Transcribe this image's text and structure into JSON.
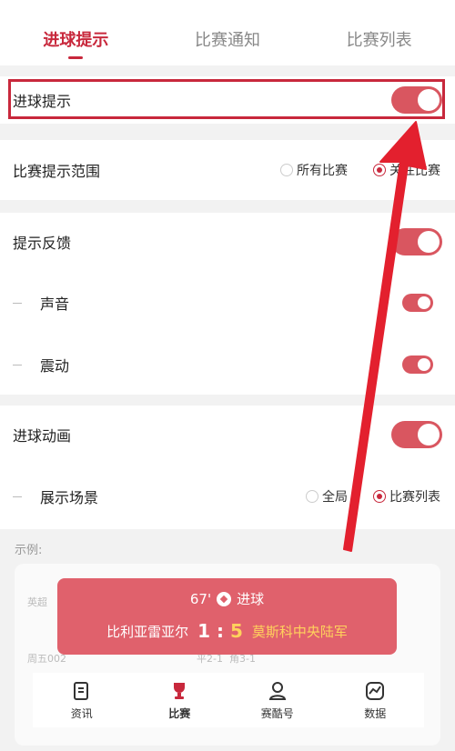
{
  "tabs": [
    {
      "label": "进球提示",
      "active": true
    },
    {
      "label": "比赛通知",
      "active": false
    },
    {
      "label": "比赛列表",
      "active": false
    }
  ],
  "settings": {
    "goal_alert": {
      "label": "进球提示",
      "on": true
    },
    "range": {
      "label": "比赛提示范围",
      "options": [
        "所有比赛",
        "关注比赛"
      ],
      "selected": "关注比赛"
    },
    "feedback": {
      "label": "提示反馈",
      "on": true
    },
    "sound": {
      "label": "声音",
      "on": true
    },
    "vibration": {
      "label": "震动",
      "on": true
    },
    "goal_animation": {
      "label": "进球动画",
      "on": true
    },
    "scene": {
      "label": "展示场景",
      "options": [
        "全局",
        "比赛列表"
      ],
      "selected": "比赛列表"
    }
  },
  "example": {
    "label": "示例:",
    "popup": {
      "minute": "67'",
      "event": "进球",
      "home": "比利亚雷亚尔",
      "home_score": "1",
      "separator": ":",
      "away_score": "5",
      "away": "莫斯科中央陆军"
    },
    "bg_rows": [
      "英超",
      "周五002",
      "平2-1",
      "角3-1"
    ]
  },
  "bottom_nav": [
    {
      "label": "资讯",
      "icon": "news-icon"
    },
    {
      "label": "比赛",
      "icon": "trophy-icon"
    },
    {
      "label": "赛酷号",
      "icon": "person-icon"
    },
    {
      "label": "数据",
      "icon": "chart-icon"
    }
  ],
  "colors": {
    "accent": "#c8283c",
    "toggle": "#d95660",
    "popup": "#e0616c",
    "highlight": "#ffd25c"
  }
}
